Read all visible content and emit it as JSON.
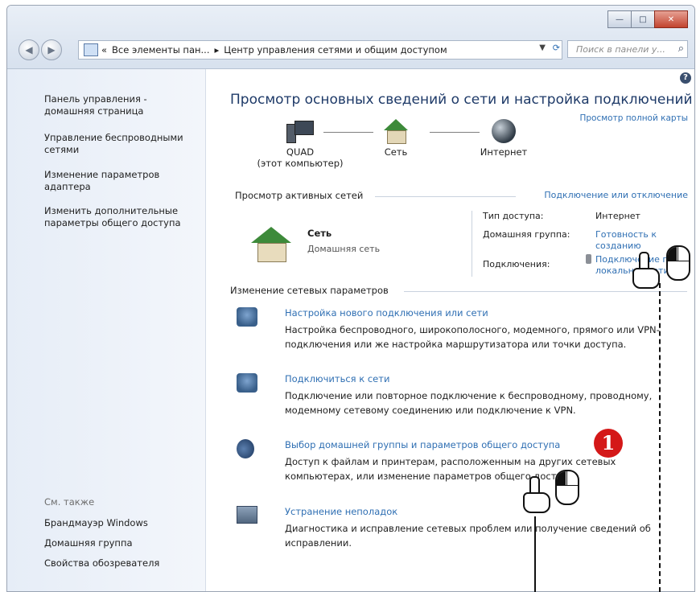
{
  "window": {
    "buttons": {
      "minimize": "—",
      "maximize": "□",
      "close": "✕"
    }
  },
  "address": {
    "prefix": "«",
    "segment1": "Все элементы пан...",
    "separator": "▸",
    "segment2": "Центр управления сетями и общим доступом",
    "search_placeholder": "Поиск в панели у..."
  },
  "sidebar": {
    "links": [
      "Панель управления - домашняя страница",
      "Управление беспроводными сетями",
      "Изменение параметров адаптера",
      "Изменить дополнительные параметры общего доступа"
    ],
    "see_also_label": "См. также",
    "see_also": [
      "Брандмауэр Windows",
      "Домашняя группа",
      "Свойства обозревателя"
    ]
  },
  "main": {
    "help": "?",
    "title": "Просмотр основных сведений о сети и настройка подключений",
    "full_map": "Просмотр полной карты",
    "map": {
      "pc_name": "QUAD",
      "pc_sub": "(этот компьютер)",
      "network": "Сеть",
      "internet": "Интернет"
    },
    "active_header": "Просмотр активных сетей",
    "connect_link": "Подключение или отключение",
    "active": {
      "name": "Сеть",
      "type": "Домашняя сеть",
      "access_key": "Тип доступа:",
      "access_val": "Интернет",
      "group_key": "Домашняя группа:",
      "group_val": "Готовность к созданию",
      "conn_key": "Подключения:",
      "conn_val": "Подключение по локальной сети"
    },
    "change_header": "Изменение сетевых параметров",
    "tasks": [
      {
        "title": "Настройка нового подключения или сети",
        "desc": "Настройка беспроводного, широкополосного, модемного, прямого или VPN-подключения или же настройка маршрутизатора или точки доступа."
      },
      {
        "title": "Подключиться к сети",
        "desc": "Подключение или повторное подключение к беспроводному, проводному, модемному сетевому соединению или подключение к VPN."
      },
      {
        "title": "Выбор домашней группы и параметров общего доступа",
        "desc": "Доступ к файлам и принтерам, расположенным на других сетевых компьютерах, или изменение параметров общего доступа."
      },
      {
        "title": "Устранение неполадок",
        "desc": "Диагностика и исправление сетевых проблем или получение сведений об исправлении."
      }
    ]
  },
  "annotation": {
    "badge": "1"
  }
}
